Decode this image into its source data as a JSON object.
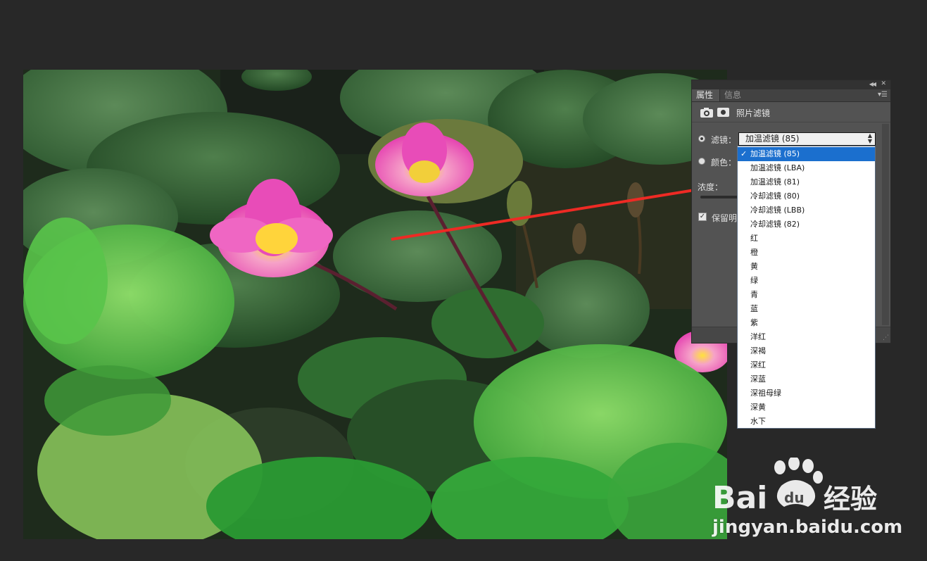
{
  "panel": {
    "tabs": [
      {
        "label": "属性",
        "active": true
      },
      {
        "label": "信息",
        "active": false
      }
    ],
    "title": "照片滤镜",
    "filter_label": "滤镜：",
    "color_label": "颜色：",
    "selected_filter": "加温滤镜 (85)",
    "density_label": "浓度：",
    "preserve_label": "保留明度",
    "preserve_checked": true
  },
  "dropdown": {
    "options": [
      "加温滤镜 (85)",
      "加温滤镜 (LBA)",
      "加温滤镜 (81)",
      "冷却滤镜 (80)",
      "冷却滤镜 (LBB)",
      "冷却滤镜 (82)",
      "红",
      "橙",
      "黄",
      "绿",
      "青",
      "蓝",
      "紫",
      "洋红",
      "深褐",
      "深红",
      "深蓝",
      "深祖母绿",
      "深黄",
      "水下"
    ],
    "selected_index": 0,
    "check_glyph": "✓"
  },
  "icons": {
    "panel_collapse": "collapse-icon",
    "panel_close": "close-icon",
    "panel_menu": "panel-menu-icon",
    "adjustment_layer": "camera-filter-icon",
    "layer_mask": "mask-icon",
    "dropdown_arrow": "chevron-updown-icon"
  },
  "colors": {
    "app_background": "#282828",
    "panel_background": "#535353",
    "dropdown_selected": "#1b6fce",
    "annotation_arrow": "#ee2a24"
  },
  "watermark": {
    "brand": "Baidu经验",
    "url": "jingyan.baidu.com"
  }
}
